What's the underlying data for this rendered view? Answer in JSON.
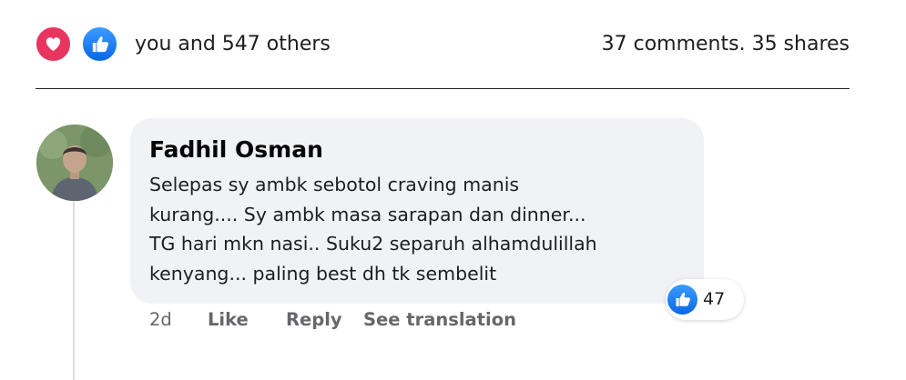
{
  "reactions": {
    "summary": "you and 547 others",
    "stats": "37 comments. 35 shares",
    "icons": [
      "heart-icon",
      "like-icon"
    ]
  },
  "comment": {
    "author": "Fadhil Osman",
    "text": "Selepas sy ambk sebotol craving manis\nkurang.... Sy ambk masa sarapan dan dinner...\nTG hari mkn nasi.. Suku2 separuh alhamdulillah\nkenyang... paling best dh tk sembelit",
    "like_count": "47",
    "time": "2d",
    "actions": {
      "like": "Like",
      "reply": "Reply",
      "translate": "See translation"
    }
  },
  "colors": {
    "heart": "#e8345f",
    "like": "#0b67e6",
    "bubble": "#f0f2f5",
    "secondary_text": "#65676b"
  }
}
